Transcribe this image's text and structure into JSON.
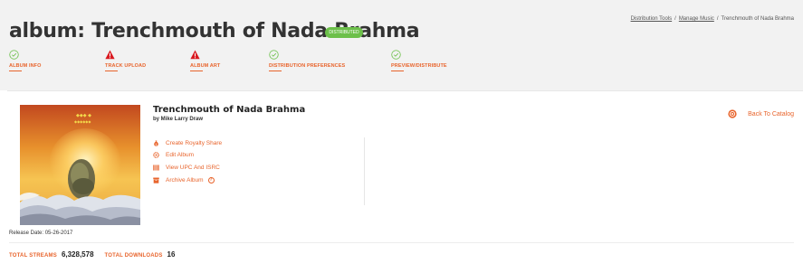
{
  "header": {
    "title": "album: Trenchmouth of Nada Brahma",
    "status_badge": "DISTRIBUTED"
  },
  "breadcrumb": {
    "items": [
      "Distribution Tools",
      "Manage Music",
      "Trenchmouth of Nada Brahma"
    ],
    "separator": "/"
  },
  "steps": [
    {
      "label": "ALBUM INFO",
      "status": "complete",
      "icon": "check-circle-icon"
    },
    {
      "label": "TRACK UPLOAD",
      "status": "warning",
      "icon": "warning-icon"
    },
    {
      "label": "ALBUM ART",
      "status": "warning",
      "icon": "warning-icon"
    },
    {
      "label": "DISTRIBUTION PREFERENCES",
      "status": "complete",
      "icon": "check-circle-icon"
    },
    {
      "label": "PREVIEW/DISTRIBUTE",
      "status": "complete",
      "icon": "check-circle-icon"
    }
  ],
  "album": {
    "name": "Trenchmouth of Nada Brahma",
    "artist_line": "by Mike Larry Draw",
    "release_date": "Release Date: 05-26-2017"
  },
  "actions": [
    {
      "label": "Create Royalty Share",
      "icon": "money-bag-icon"
    },
    {
      "label": "Edit Album",
      "icon": "gear-icon"
    },
    {
      "label": "View UPC And ISRC",
      "icon": "barcode-icon"
    },
    {
      "label": "Archive Album",
      "icon": "archive-box-icon",
      "help_icon": "?"
    }
  ],
  "back_link": {
    "label": "Back To Catalog",
    "icon": "back-arrow-icon"
  },
  "stats": {
    "streams_label": "TOTAL STREAMS",
    "streams_value": "6,328,578",
    "downloads_label": "TOTAL DOWNLOADS",
    "downloads_value": "16"
  },
  "colors": {
    "accent": "#e8642c",
    "success": "#6cc04a",
    "danger": "#d9181f",
    "header_bg": "#f2f2f2"
  }
}
